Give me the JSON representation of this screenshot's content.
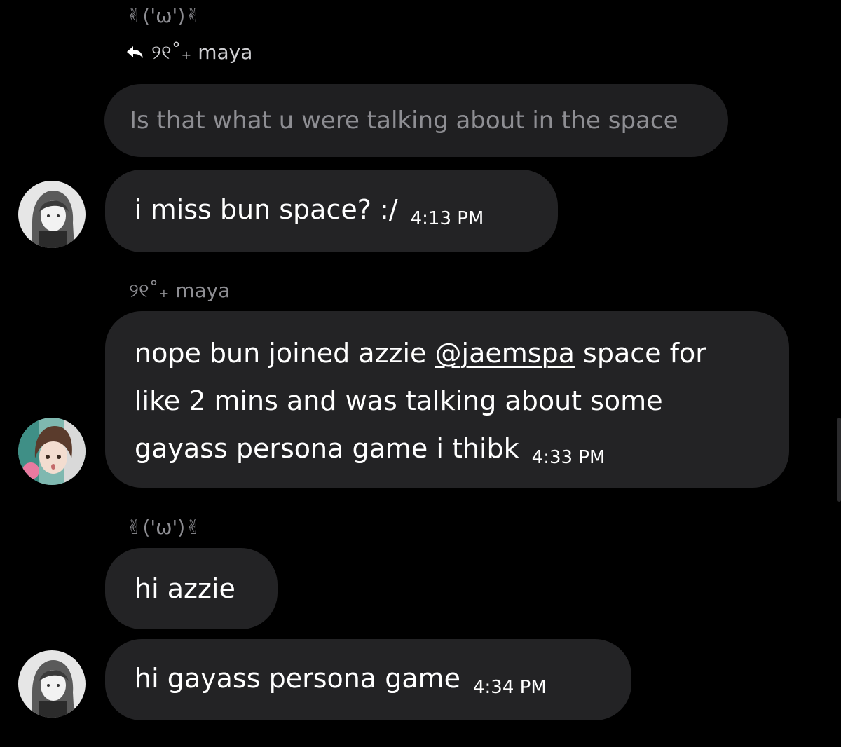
{
  "thread": {
    "messages": [
      {
        "sender_name": "✌︎('ω')✌︎",
        "reply_to_name": "୨୧˚₊ maya",
        "quoted_text": "Is that what u were talking about in the space",
        "text": "i miss bun space? :/",
        "time": "4:13 PM"
      },
      {
        "sender_name": "୨୧˚₊ maya",
        "text_before_mention": "nope bun joined azzie ",
        "mention": "@jaemspa",
        "text_after_mention": " space for like 2 mins and was talking about some gayass persona game i thibk",
        "time": "4:33 PM"
      },
      {
        "sender_name": "✌︎('ω')✌︎",
        "text": "hi azzie"
      },
      {
        "text": "hi gayass persona game",
        "time": "4:34 PM"
      }
    ]
  },
  "icons": {
    "reply": "reply-arrow-icon",
    "avatar_1": "avatar-grayscale-character",
    "avatar_2": "avatar-brown-hair-character"
  },
  "colors": {
    "background": "#000000",
    "bubble": "#232325",
    "quoted_bubble": "#1f1f21",
    "secondary_text": "#8e8e93",
    "primary_text": "#ffffff"
  }
}
